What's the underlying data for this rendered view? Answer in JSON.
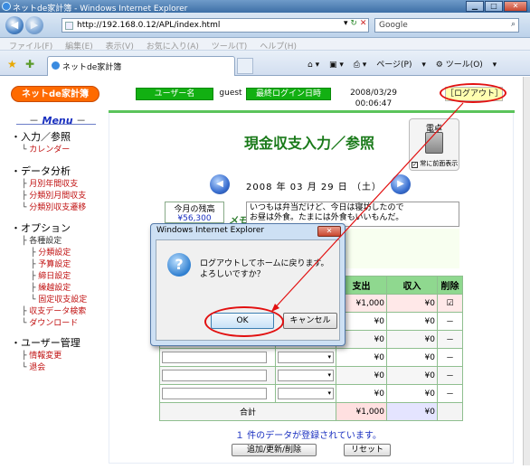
{
  "window": {
    "title": "ネットde家計簿 - Windows Internet Explorer",
    "min_icon": "minimize-icon",
    "max_icon": "maximize-icon",
    "close_icon": "close-icon"
  },
  "addressbar": {
    "url": "http://192.168.0.12/APL/index.html",
    "search_placeholder": "Google"
  },
  "menu": [
    "ファイル(F)",
    "編集(E)",
    "表示(V)",
    "お気に入り(A)",
    "ツール(T)",
    "ヘルプ(H)"
  ],
  "tab": {
    "label": "ネットde家計簿"
  },
  "toolbar": {
    "page": "ページ(P)",
    "tools": "ツール(O)"
  },
  "app": {
    "logo": "ネットde家計簿",
    "user_label": "ユーザー名",
    "user_value": "guest",
    "login_label": "最終ログイン日時",
    "login_value": "2008/03/29 00:06:47",
    "logout": "［ログアウト］"
  },
  "sidebar": {
    "menu_title": "Menu",
    "sections": [
      {
        "title": "・入力／参照",
        "items": [
          "カレンダー"
        ]
      },
      {
        "title": "・データ分析",
        "items": [
          "月別年間収支",
          "分類別月間収支",
          "分類別収支遷移"
        ]
      },
      {
        "title": "・オプション",
        "items": [
          "各種設定",
          "分類設定",
          "予算設定",
          "締日設定",
          "繰越設定",
          "固定収支設定",
          "収支データ検索",
          "ダウンロード"
        ]
      },
      {
        "title": "・ユーザー管理",
        "items": [
          "情報変更",
          "退会"
        ]
      }
    ]
  },
  "main": {
    "title": "現金収支入力／参照",
    "calc_label": "電卓",
    "calc_check": "常に前面表示",
    "date": "2008 年 03 月 29 日 （土）",
    "balance_label": "今月の残高",
    "balance_value": "¥56,300",
    "memo_label": "メモ",
    "memo_line1": "いつもは弁当だけど、今日は寝坊したので",
    "memo_line2": "お昼は外食。たまには外食もいいもんだ。",
    "headers": {
      "expense": "支出",
      "income": "収入",
      "delete": "削除"
    },
    "rows": [
      {
        "expense": "¥1,000",
        "income": "¥0",
        "delete": "☑"
      },
      {
        "expense": "¥0",
        "income": "¥0",
        "delete": "－"
      },
      {
        "expense": "¥0",
        "income": "¥0",
        "delete": "－"
      },
      {
        "expense": "¥0",
        "income": "¥0",
        "delete": "－"
      },
      {
        "expense": "¥0",
        "income": "¥0",
        "delete": "－"
      },
      {
        "expense": "¥0",
        "income": "¥0",
        "delete": "－"
      }
    ],
    "total_label": "合計",
    "total_expense": "¥1,000",
    "total_income": "¥0",
    "registered_msg": "１ 件のデータが登録されています。",
    "submit": "追加/更新/削除",
    "reset": "リセット"
  },
  "dialog": {
    "title": "Windows Internet Explorer",
    "line1": "ログアウトしてホームに戻ります。",
    "line2": "よろしいですか？",
    "ok": "OK",
    "cancel": "キャンセル"
  },
  "colors": {
    "annotation_red": "#e21010",
    "accent_green": "#12b012",
    "logo_orange": "#ff6a00"
  }
}
